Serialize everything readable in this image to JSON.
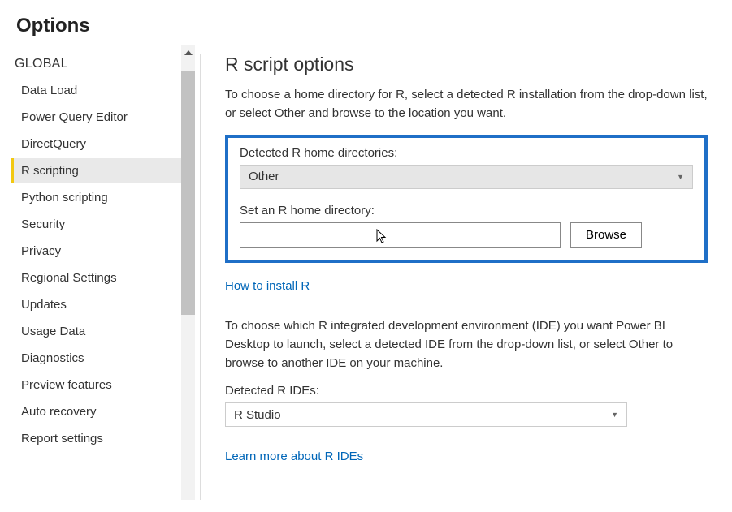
{
  "page_title": "Options",
  "sidebar": {
    "section_label": "GLOBAL",
    "items": [
      {
        "label": "Data Load"
      },
      {
        "label": "Power Query Editor"
      },
      {
        "label": "DirectQuery"
      },
      {
        "label": "R scripting"
      },
      {
        "label": "Python scripting"
      },
      {
        "label": "Security"
      },
      {
        "label": "Privacy"
      },
      {
        "label": "Regional Settings"
      },
      {
        "label": "Updates"
      },
      {
        "label": "Usage Data"
      },
      {
        "label": "Diagnostics"
      },
      {
        "label": "Preview features"
      },
      {
        "label": "Auto recovery"
      },
      {
        "label": "Report settings"
      }
    ],
    "active_index": 3
  },
  "main": {
    "title": "R script options",
    "home_desc": "To choose a home directory for R, select a detected R installation from the drop-down list, or select Other and browse to the location you want.",
    "detected_label": "Detected R home directories:",
    "detected_value": "Other",
    "set_home_label": "Set an R home directory:",
    "home_input_value": "",
    "browse_label": "Browse",
    "how_to_link": "How to install R",
    "ide_desc": "To choose which R integrated development environment (IDE) you want Power BI Desktop to launch, select a detected IDE from the drop-down list, or select Other to browse to another IDE on your machine.",
    "ide_label": "Detected R IDEs:",
    "ide_value": "R Studio",
    "ide_link": "Learn more about R IDEs"
  }
}
